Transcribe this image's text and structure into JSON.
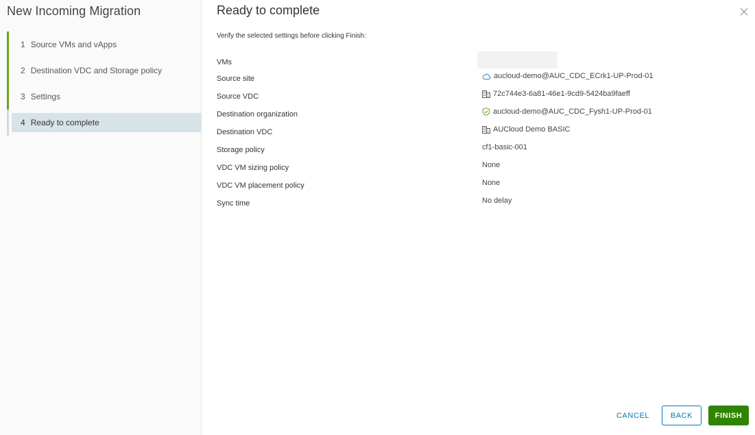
{
  "wizard": {
    "title": "New Incoming Migration",
    "steps": [
      {
        "num": "1",
        "label": "Source VMs and vApps"
      },
      {
        "num": "2",
        "label": "Destination VDC and Storage policy"
      },
      {
        "num": "3",
        "label": "Settings"
      },
      {
        "num": "4",
        "label": "Ready to complete"
      }
    ],
    "active_step": 4
  },
  "page": {
    "title": "Ready to complete",
    "instructions": "Verify the selected settings before clicking Finish:"
  },
  "summary": {
    "vms": {
      "label": "VMs"
    },
    "source_site": {
      "label": "Source site",
      "value": "aucloud-demo@AUC_CDC_ECrk1-UP-Prod-01",
      "icon": "cloud-icon"
    },
    "source_vdc": {
      "label": "Source VDC",
      "value": "72c744e3-6a81-46e1-9cd9-5424ba9faeff",
      "icon": "building-icon"
    },
    "destination_org": {
      "label": "Destination organization",
      "value": "aucloud-demo@AUC_CDC_Fysh1-UP-Prod-01",
      "icon": "shield-check-icon"
    },
    "destination_vdc": {
      "label": "Destination VDC",
      "value": "AUCloud Demo BASIC",
      "icon": "building-icon"
    },
    "storage_policy": {
      "label": "Storage policy",
      "value": "cf1-basic-001"
    },
    "sizing_policy": {
      "label": "VDC VM sizing policy",
      "value": "None"
    },
    "placement_policy": {
      "label": "VDC VM placement policy",
      "value": "None"
    },
    "sync_time": {
      "label": "Sync time",
      "value": "No delay"
    }
  },
  "buttons": {
    "cancel": "CANCEL",
    "back": "BACK",
    "finish": "FINISH"
  },
  "colors": {
    "accent_green": "#62a420",
    "finish_green": "#2f8400",
    "link_blue": "#0079b8",
    "active_step_bg": "#d8e3e9"
  }
}
